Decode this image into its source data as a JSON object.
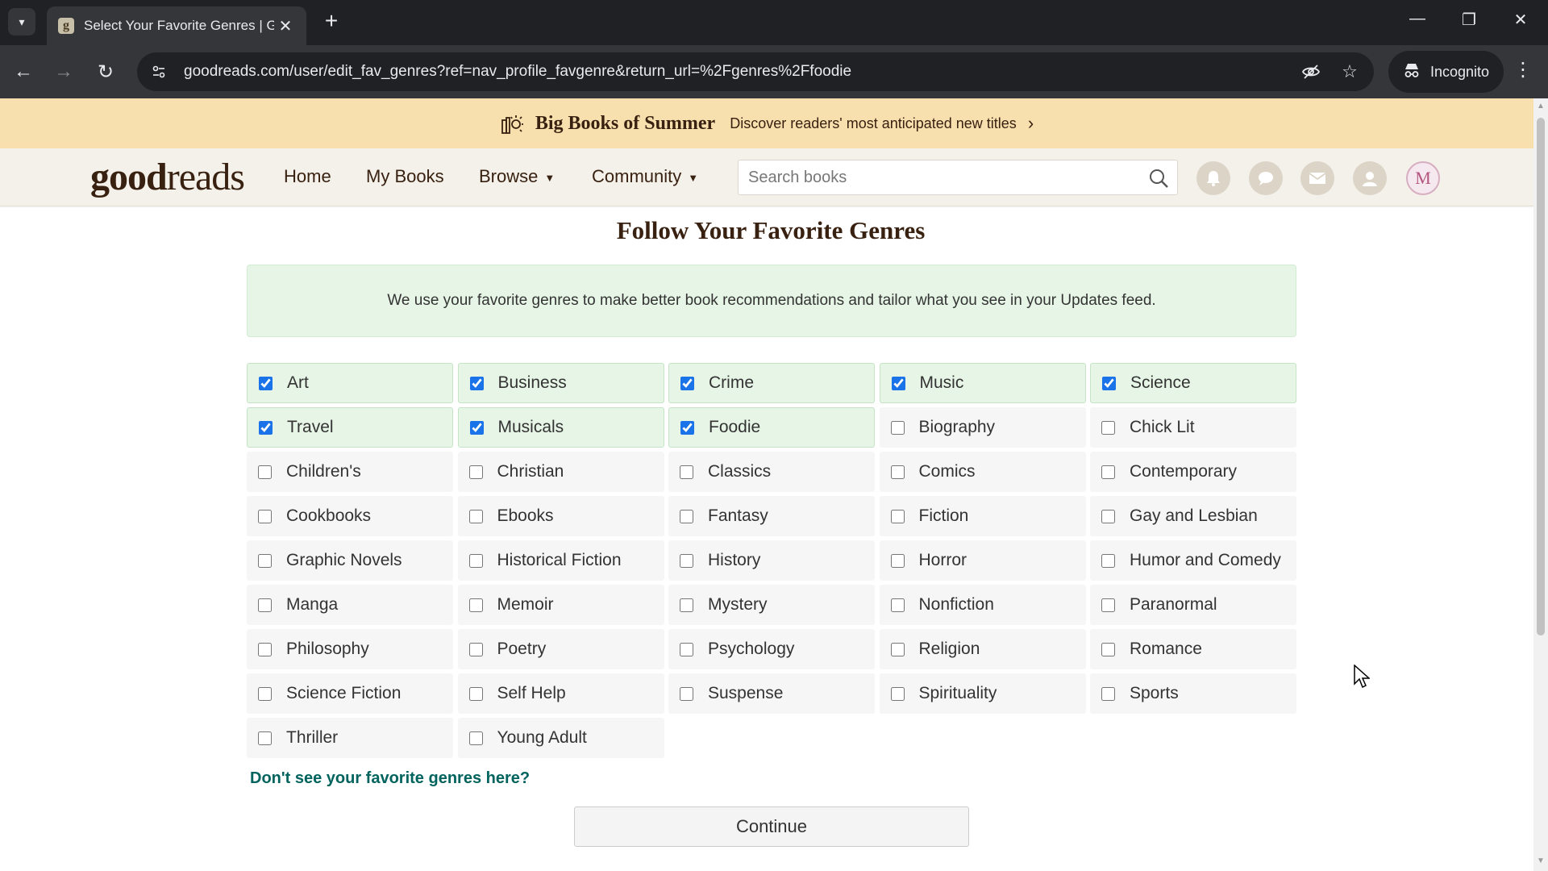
{
  "browser": {
    "tab_list_icon": "chevron-down-icon",
    "tab": {
      "title": "Select Your Favorite Genres | Gc",
      "favicon": "g"
    },
    "url": "goodreads.com/user/edit_fav_genres?ref=nav_profile_favgenre&return_url=%2Fgenres%2Ffoodie",
    "incognito_label": "Incognito"
  },
  "promo": {
    "title": "Big Books of Summer",
    "subtitle": "Discover readers' most anticipated new titles"
  },
  "header": {
    "logo_bold": "good",
    "logo_light": "reads",
    "nav": [
      "Home",
      "My Books",
      "Browse",
      "Community"
    ],
    "search_placeholder": "Search books",
    "avatar_letter": "M"
  },
  "page": {
    "title": "Follow Your Favorite Genres",
    "info": "We use your favorite genres to make better book recommendations and tailor what you see in your Updates feed.",
    "more_link": "Don't see your favorite genres here?",
    "continue_label": "Continue"
  },
  "genres": [
    {
      "label": "Art",
      "checked": true
    },
    {
      "label": "Business",
      "checked": true
    },
    {
      "label": "Crime",
      "checked": true
    },
    {
      "label": "Music",
      "checked": true
    },
    {
      "label": "Science",
      "checked": true
    },
    {
      "label": "Travel",
      "checked": true
    },
    {
      "label": "Musicals",
      "checked": true
    },
    {
      "label": "Foodie",
      "checked": true
    },
    {
      "label": "Biography",
      "checked": false
    },
    {
      "label": "Chick Lit",
      "checked": false
    },
    {
      "label": "Children's",
      "checked": false
    },
    {
      "label": "Christian",
      "checked": false
    },
    {
      "label": "Classics",
      "checked": false
    },
    {
      "label": "Comics",
      "checked": false
    },
    {
      "label": "Contemporary",
      "checked": false
    },
    {
      "label": "Cookbooks",
      "checked": false
    },
    {
      "label": "Ebooks",
      "checked": false
    },
    {
      "label": "Fantasy",
      "checked": false
    },
    {
      "label": "Fiction",
      "checked": false
    },
    {
      "label": "Gay and Lesbian",
      "checked": false
    },
    {
      "label": "Graphic Novels",
      "checked": false
    },
    {
      "label": "Historical Fiction",
      "checked": false
    },
    {
      "label": "History",
      "checked": false
    },
    {
      "label": "Horror",
      "checked": false
    },
    {
      "label": "Humor and Comedy",
      "checked": false
    },
    {
      "label": "Manga",
      "checked": false
    },
    {
      "label": "Memoir",
      "checked": false
    },
    {
      "label": "Mystery",
      "checked": false
    },
    {
      "label": "Nonfiction",
      "checked": false
    },
    {
      "label": "Paranormal",
      "checked": false
    },
    {
      "label": "Philosophy",
      "checked": false
    },
    {
      "label": "Poetry",
      "checked": false
    },
    {
      "label": "Psychology",
      "checked": false
    },
    {
      "label": "Religion",
      "checked": false
    },
    {
      "label": "Romance",
      "checked": false
    },
    {
      "label": "Science Fiction",
      "checked": false
    },
    {
      "label": "Self Help",
      "checked": false
    },
    {
      "label": "Suspense",
      "checked": false
    },
    {
      "label": "Spirituality",
      "checked": false
    },
    {
      "label": "Sports",
      "checked": false
    },
    {
      "label": "Thriller",
      "checked": false
    },
    {
      "label": "Young Adult",
      "checked": false
    }
  ],
  "colors": {
    "brand_brown": "#382110",
    "header_bg": "#f4f1ea",
    "promo_bg": "#f8dfae",
    "checked_bg": "#e6f5e6",
    "link_green": "#00635d"
  }
}
